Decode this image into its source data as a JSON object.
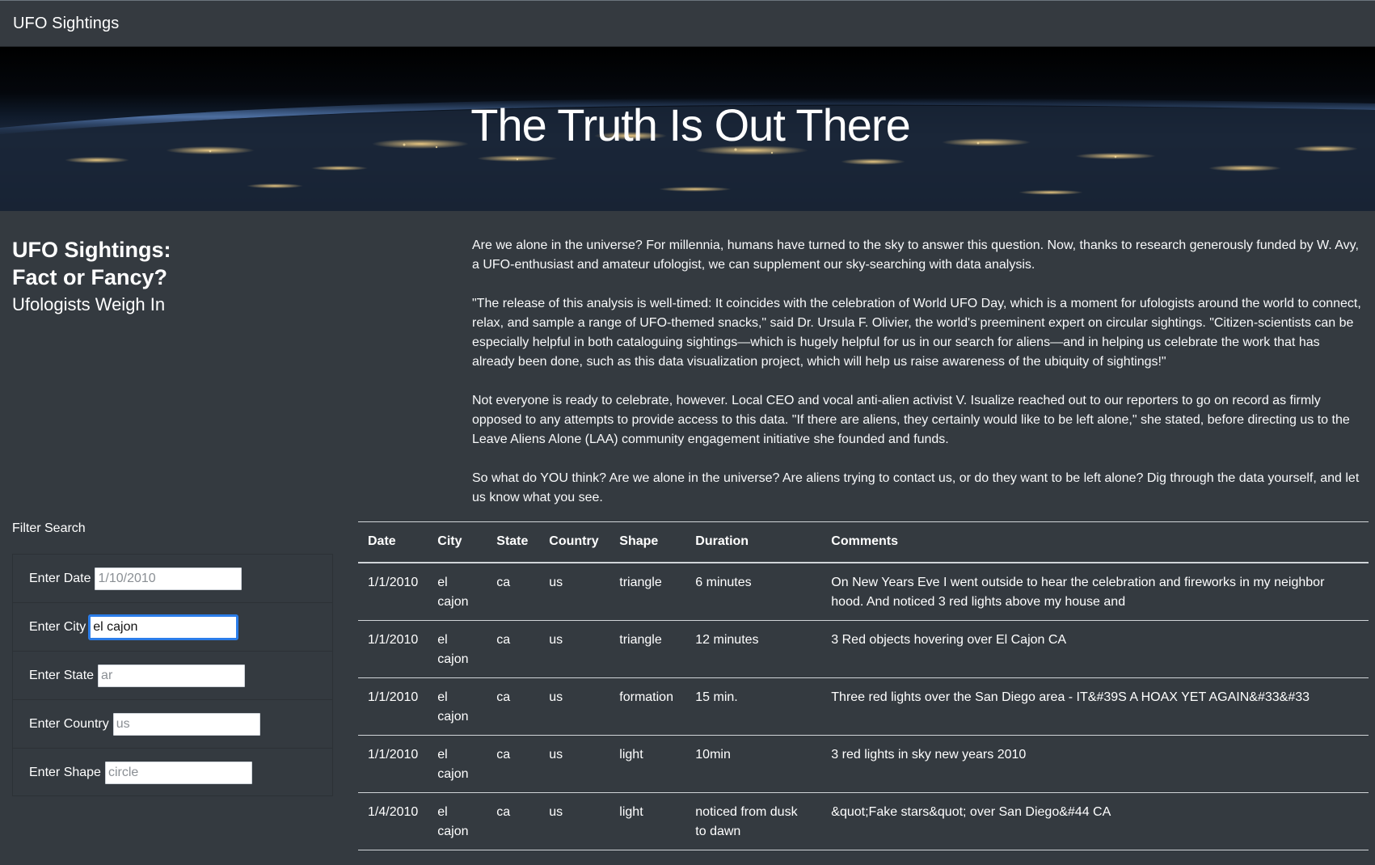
{
  "navbar": {
    "brand": "UFO Sightings"
  },
  "hero": {
    "title": "The Truth Is Out There"
  },
  "side": {
    "title_line1": "UFO Sightings:",
    "title_line2": "Fact or Fancy?",
    "subtitle": "Ufologists Weigh In"
  },
  "article": {
    "paragraphs": [
      "Are we alone in the universe? For millennia, humans have turned to the sky to answer this question. Now, thanks to research generously funded by W. Avy, a UFO-enthusiast and amateur ufologist, we can supplement our sky-searching with data analysis.",
      "\"The release of this analysis is well-timed: It coincides with the celebration of World UFO Day, which is a moment for ufologists around the world to connect, relax, and sample a range of UFO-themed snacks,\" said Dr. Ursula F. Olivier, the world's preeminent expert on circular sightings. \"Citizen-scientists can be especially helpful in both cataloguing sightings—which is hugely helpful for us in our search for aliens—and in helping us celebrate the work that has already been done, such as this data visualization project, which will help us raise awareness of the ubiquity of sightings!\"",
      "Not everyone is ready to celebrate, however. Local CEO and vocal anti-alien activist V. Isualize reached out to our reporters to go on record as firmly opposed to any attempts to provide access to this data. \"If there are aliens, they certainly would like to be left alone,\" she stated, before directing us to the Leave Aliens Alone (LAA) community engagement initiative she founded and funds.",
      "So what do YOU think? Are we alone in the universe? Are aliens trying to contact us, or do they want to be left alone? Dig through the data yourself, and let us know what you see."
    ]
  },
  "filters": {
    "title": "Filter Search",
    "date": {
      "label": "Enter Date",
      "value": "",
      "placeholder": "1/10/2010"
    },
    "city": {
      "label": "Enter City",
      "value": "el cajon",
      "placeholder": ""
    },
    "state": {
      "label": "Enter State",
      "value": "",
      "placeholder": "ar"
    },
    "country": {
      "label": "Enter Country",
      "value": "",
      "placeholder": "us"
    },
    "shape": {
      "label": "Enter Shape",
      "value": "",
      "placeholder": "circle"
    }
  },
  "table": {
    "headers": [
      "Date",
      "City",
      "State",
      "Country",
      "Shape",
      "Duration",
      "Comments"
    ],
    "rows": [
      [
        "1/1/2010",
        "el cajon",
        "ca",
        "us",
        "triangle",
        "6 minutes",
        "On New Years Eve I went outside to hear the celebration and fireworks in my neighbor hood. And noticed 3 red lights above my house and"
      ],
      [
        "1/1/2010",
        "el cajon",
        "ca",
        "us",
        "triangle",
        "12 minutes",
        "3 Red objects hovering over El Cajon CA"
      ],
      [
        "1/1/2010",
        "el cajon",
        "ca",
        "us",
        "formation",
        "15 min.",
        "Three red lights over the San Diego area - IT&#39S A HOAX YET AGAIN&#33&#33"
      ],
      [
        "1/1/2010",
        "el cajon",
        "ca",
        "us",
        "light",
        "10min",
        "3 red lights in sky new years 2010"
      ],
      [
        "1/4/2010",
        "el cajon",
        "ca",
        "us",
        "light",
        "noticed from dusk to dawn",
        "&quot;Fake stars&quot; over San Diego&#44 CA"
      ]
    ]
  },
  "colors": {
    "page_bg": "#343a40",
    "focus_ring": "#2b7de9"
  }
}
